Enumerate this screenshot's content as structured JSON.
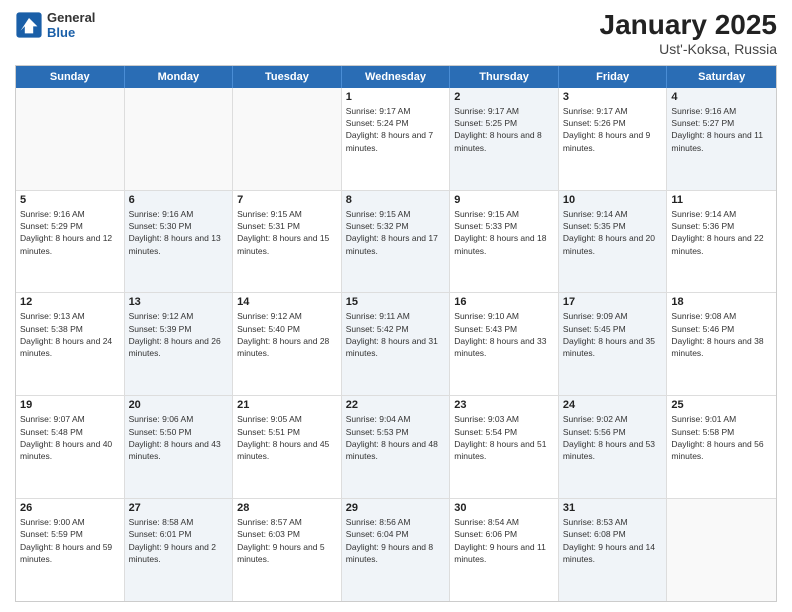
{
  "header": {
    "logo_general": "General",
    "logo_blue": "Blue",
    "title": "January 2025",
    "subtitle": "Ust'-Koksa, Russia"
  },
  "days_of_week": [
    "Sunday",
    "Monday",
    "Tuesday",
    "Wednesday",
    "Thursday",
    "Friday",
    "Saturday"
  ],
  "weeks": [
    [
      {
        "day": "",
        "info": "",
        "shaded": false,
        "empty": true
      },
      {
        "day": "",
        "info": "",
        "shaded": false,
        "empty": true
      },
      {
        "day": "",
        "info": "",
        "shaded": false,
        "empty": true
      },
      {
        "day": "1",
        "info": "Sunrise: 9:17 AM\nSunset: 5:24 PM\nDaylight: 8 hours and 7 minutes.",
        "shaded": false,
        "empty": false
      },
      {
        "day": "2",
        "info": "Sunrise: 9:17 AM\nSunset: 5:25 PM\nDaylight: 8 hours and 8 minutes.",
        "shaded": true,
        "empty": false
      },
      {
        "day": "3",
        "info": "Sunrise: 9:17 AM\nSunset: 5:26 PM\nDaylight: 8 hours and 9 minutes.",
        "shaded": false,
        "empty": false
      },
      {
        "day": "4",
        "info": "Sunrise: 9:16 AM\nSunset: 5:27 PM\nDaylight: 8 hours and 11 minutes.",
        "shaded": true,
        "empty": false
      }
    ],
    [
      {
        "day": "5",
        "info": "Sunrise: 9:16 AM\nSunset: 5:29 PM\nDaylight: 8 hours and 12 minutes.",
        "shaded": false,
        "empty": false
      },
      {
        "day": "6",
        "info": "Sunrise: 9:16 AM\nSunset: 5:30 PM\nDaylight: 8 hours and 13 minutes.",
        "shaded": true,
        "empty": false
      },
      {
        "day": "7",
        "info": "Sunrise: 9:15 AM\nSunset: 5:31 PM\nDaylight: 8 hours and 15 minutes.",
        "shaded": false,
        "empty": false
      },
      {
        "day": "8",
        "info": "Sunrise: 9:15 AM\nSunset: 5:32 PM\nDaylight: 8 hours and 17 minutes.",
        "shaded": true,
        "empty": false
      },
      {
        "day": "9",
        "info": "Sunrise: 9:15 AM\nSunset: 5:33 PM\nDaylight: 8 hours and 18 minutes.",
        "shaded": false,
        "empty": false
      },
      {
        "day": "10",
        "info": "Sunrise: 9:14 AM\nSunset: 5:35 PM\nDaylight: 8 hours and 20 minutes.",
        "shaded": true,
        "empty": false
      },
      {
        "day": "11",
        "info": "Sunrise: 9:14 AM\nSunset: 5:36 PM\nDaylight: 8 hours and 22 minutes.",
        "shaded": false,
        "empty": false
      }
    ],
    [
      {
        "day": "12",
        "info": "Sunrise: 9:13 AM\nSunset: 5:38 PM\nDaylight: 8 hours and 24 minutes.",
        "shaded": false,
        "empty": false
      },
      {
        "day": "13",
        "info": "Sunrise: 9:12 AM\nSunset: 5:39 PM\nDaylight: 8 hours and 26 minutes.",
        "shaded": true,
        "empty": false
      },
      {
        "day": "14",
        "info": "Sunrise: 9:12 AM\nSunset: 5:40 PM\nDaylight: 8 hours and 28 minutes.",
        "shaded": false,
        "empty": false
      },
      {
        "day": "15",
        "info": "Sunrise: 9:11 AM\nSunset: 5:42 PM\nDaylight: 8 hours and 31 minutes.",
        "shaded": true,
        "empty": false
      },
      {
        "day": "16",
        "info": "Sunrise: 9:10 AM\nSunset: 5:43 PM\nDaylight: 8 hours and 33 minutes.",
        "shaded": false,
        "empty": false
      },
      {
        "day": "17",
        "info": "Sunrise: 9:09 AM\nSunset: 5:45 PM\nDaylight: 8 hours and 35 minutes.",
        "shaded": true,
        "empty": false
      },
      {
        "day": "18",
        "info": "Sunrise: 9:08 AM\nSunset: 5:46 PM\nDaylight: 8 hours and 38 minutes.",
        "shaded": false,
        "empty": false
      }
    ],
    [
      {
        "day": "19",
        "info": "Sunrise: 9:07 AM\nSunset: 5:48 PM\nDaylight: 8 hours and 40 minutes.",
        "shaded": false,
        "empty": false
      },
      {
        "day": "20",
        "info": "Sunrise: 9:06 AM\nSunset: 5:50 PM\nDaylight: 8 hours and 43 minutes.",
        "shaded": true,
        "empty": false
      },
      {
        "day": "21",
        "info": "Sunrise: 9:05 AM\nSunset: 5:51 PM\nDaylight: 8 hours and 45 minutes.",
        "shaded": false,
        "empty": false
      },
      {
        "day": "22",
        "info": "Sunrise: 9:04 AM\nSunset: 5:53 PM\nDaylight: 8 hours and 48 minutes.",
        "shaded": true,
        "empty": false
      },
      {
        "day": "23",
        "info": "Sunrise: 9:03 AM\nSunset: 5:54 PM\nDaylight: 8 hours and 51 minutes.",
        "shaded": false,
        "empty": false
      },
      {
        "day": "24",
        "info": "Sunrise: 9:02 AM\nSunset: 5:56 PM\nDaylight: 8 hours and 53 minutes.",
        "shaded": true,
        "empty": false
      },
      {
        "day": "25",
        "info": "Sunrise: 9:01 AM\nSunset: 5:58 PM\nDaylight: 8 hours and 56 minutes.",
        "shaded": false,
        "empty": false
      }
    ],
    [
      {
        "day": "26",
        "info": "Sunrise: 9:00 AM\nSunset: 5:59 PM\nDaylight: 8 hours and 59 minutes.",
        "shaded": false,
        "empty": false
      },
      {
        "day": "27",
        "info": "Sunrise: 8:58 AM\nSunset: 6:01 PM\nDaylight: 9 hours and 2 minutes.",
        "shaded": true,
        "empty": false
      },
      {
        "day": "28",
        "info": "Sunrise: 8:57 AM\nSunset: 6:03 PM\nDaylight: 9 hours and 5 minutes.",
        "shaded": false,
        "empty": false
      },
      {
        "day": "29",
        "info": "Sunrise: 8:56 AM\nSunset: 6:04 PM\nDaylight: 9 hours and 8 minutes.",
        "shaded": true,
        "empty": false
      },
      {
        "day": "30",
        "info": "Sunrise: 8:54 AM\nSunset: 6:06 PM\nDaylight: 9 hours and 11 minutes.",
        "shaded": false,
        "empty": false
      },
      {
        "day": "31",
        "info": "Sunrise: 8:53 AM\nSunset: 6:08 PM\nDaylight: 9 hours and 14 minutes.",
        "shaded": true,
        "empty": false
      },
      {
        "day": "",
        "info": "",
        "shaded": false,
        "empty": true
      }
    ]
  ]
}
